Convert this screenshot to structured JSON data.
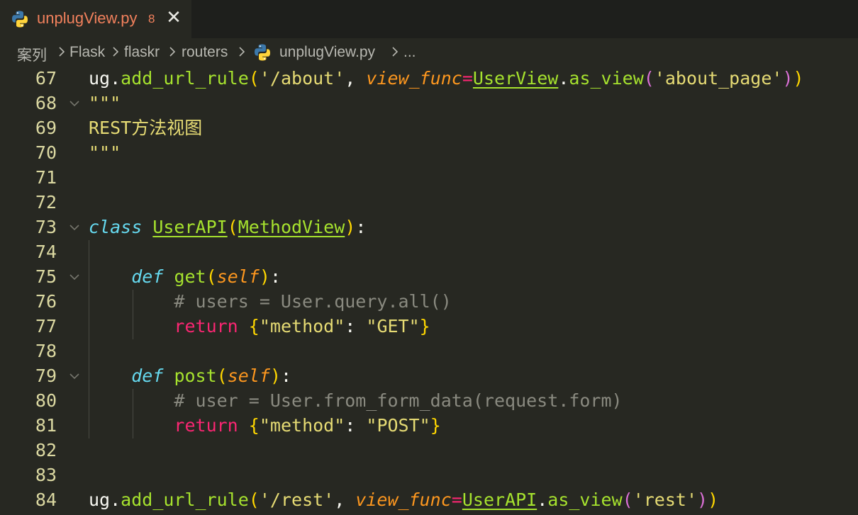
{
  "tab": {
    "file_name": "unplugView.py",
    "problem_count": "8",
    "close_glyph": "✕"
  },
  "breadcrumb": {
    "items": [
      "案列",
      "Flask",
      "flaskr",
      "routers",
      "unplugView.py",
      "..."
    ]
  },
  "colors": {
    "background": "#272822",
    "tab_bar": "#1e1f1c",
    "tab_title": "#f0805c",
    "line_number": "#dcd9a2",
    "function": "#a6e22e",
    "string": "#e6db74",
    "keyword": "#f92672",
    "def_keyword": "#66d9ef",
    "parameter": "#fd971f",
    "comment": "#8a8a80"
  },
  "icons": {
    "tab_icon": "python-icon",
    "breadcrumb_file_icon": "python-icon",
    "breadcrumb_separator": "chevron-right-icon",
    "fold": "chevron-down-icon"
  },
  "editor": {
    "lines": [
      {
        "num": "67",
        "fold": false,
        "tokens": [
          {
            "t": "ug",
            "c": "plain"
          },
          {
            "t": ".",
            "c": "plain"
          },
          {
            "t": "add_url_rule",
            "c": "func"
          },
          {
            "t": "(",
            "c": "b1"
          },
          {
            "t": "'/about'",
            "c": "str"
          },
          {
            "t": ", ",
            "c": "plain"
          },
          {
            "t": "view_func",
            "c": "param"
          },
          {
            "t": "=",
            "c": "kw"
          },
          {
            "t": "UserView",
            "c": "cls"
          },
          {
            "t": ".",
            "c": "plain"
          },
          {
            "t": "as_view",
            "c": "func"
          },
          {
            "t": "(",
            "c": "b2"
          },
          {
            "t": "'about_page'",
            "c": "str"
          },
          {
            "t": ")",
            "c": "b2"
          },
          {
            "t": ")",
            "c": "b1"
          }
        ]
      },
      {
        "num": "68",
        "fold": true,
        "tokens": [
          {
            "t": "\"\"\"",
            "c": "str"
          }
        ]
      },
      {
        "num": "69",
        "fold": false,
        "tokens": [
          {
            "t": "REST方法视图",
            "c": "str"
          }
        ]
      },
      {
        "num": "70",
        "fold": false,
        "tokens": [
          {
            "t": "\"\"\"",
            "c": "str"
          }
        ]
      },
      {
        "num": "71",
        "fold": false,
        "tokens": []
      },
      {
        "num": "72",
        "fold": false,
        "tokens": []
      },
      {
        "num": "73",
        "fold": true,
        "tokens": [
          {
            "t": "class",
            "c": "def"
          },
          {
            "t": " ",
            "c": "plain"
          },
          {
            "t": "UserAPI",
            "c": "cls"
          },
          {
            "t": "(",
            "c": "b1"
          },
          {
            "t": "MethodView",
            "c": "cls"
          },
          {
            "t": ")",
            "c": "b1"
          },
          {
            "t": ":",
            "c": "plain"
          }
        ]
      },
      {
        "num": "74",
        "fold": false,
        "tokens": []
      },
      {
        "num": "75",
        "fold": true,
        "tokens": [
          {
            "t": "    ",
            "c": "plain"
          },
          {
            "t": "def",
            "c": "def"
          },
          {
            "t": " ",
            "c": "plain"
          },
          {
            "t": "get",
            "c": "func"
          },
          {
            "t": "(",
            "c": "b1"
          },
          {
            "t": "self",
            "c": "param"
          },
          {
            "t": ")",
            "c": "b1"
          },
          {
            "t": ":",
            "c": "plain"
          }
        ]
      },
      {
        "num": "76",
        "fold": false,
        "tokens": [
          {
            "t": "        ",
            "c": "plain"
          },
          {
            "t": "# users = User.query.all()",
            "c": "com"
          }
        ]
      },
      {
        "num": "77",
        "fold": false,
        "tokens": [
          {
            "t": "        ",
            "c": "plain"
          },
          {
            "t": "return",
            "c": "kw"
          },
          {
            "t": " ",
            "c": "plain"
          },
          {
            "t": "{",
            "c": "b1"
          },
          {
            "t": "\"method\"",
            "c": "str"
          },
          {
            "t": ": ",
            "c": "plain"
          },
          {
            "t": "\"GET\"",
            "c": "str"
          },
          {
            "t": "}",
            "c": "b1"
          }
        ]
      },
      {
        "num": "78",
        "fold": false,
        "tokens": []
      },
      {
        "num": "79",
        "fold": true,
        "tokens": [
          {
            "t": "    ",
            "c": "plain"
          },
          {
            "t": "def",
            "c": "def"
          },
          {
            "t": " ",
            "c": "plain"
          },
          {
            "t": "post",
            "c": "func"
          },
          {
            "t": "(",
            "c": "b1"
          },
          {
            "t": "self",
            "c": "param"
          },
          {
            "t": ")",
            "c": "b1"
          },
          {
            "t": ":",
            "c": "plain"
          }
        ]
      },
      {
        "num": "80",
        "fold": false,
        "tokens": [
          {
            "t": "        ",
            "c": "plain"
          },
          {
            "t": "# user = User.from_form_data(request.form)",
            "c": "com"
          }
        ]
      },
      {
        "num": "81",
        "fold": false,
        "tokens": [
          {
            "t": "        ",
            "c": "plain"
          },
          {
            "t": "return",
            "c": "kw"
          },
          {
            "t": " ",
            "c": "plain"
          },
          {
            "t": "{",
            "c": "b1"
          },
          {
            "t": "\"method\"",
            "c": "str"
          },
          {
            "t": ": ",
            "c": "plain"
          },
          {
            "t": "\"POST\"",
            "c": "str"
          },
          {
            "t": "}",
            "c": "b1"
          }
        ]
      },
      {
        "num": "82",
        "fold": false,
        "tokens": []
      },
      {
        "num": "83",
        "fold": false,
        "tokens": []
      },
      {
        "num": "84",
        "fold": false,
        "tokens": [
          {
            "t": "ug",
            "c": "plain"
          },
          {
            "t": ".",
            "c": "plain"
          },
          {
            "t": "add_url_rule",
            "c": "func"
          },
          {
            "t": "(",
            "c": "b1"
          },
          {
            "t": "'/rest'",
            "c": "str"
          },
          {
            "t": ", ",
            "c": "plain"
          },
          {
            "t": "view_func",
            "c": "param"
          },
          {
            "t": "=",
            "c": "kw"
          },
          {
            "t": "UserAPI",
            "c": "cls"
          },
          {
            "t": ".",
            "c": "plain"
          },
          {
            "t": "as_view",
            "c": "func"
          },
          {
            "t": "(",
            "c": "b2"
          },
          {
            "t": "'rest'",
            "c": "str"
          },
          {
            "t": ")",
            "c": "b2"
          },
          {
            "t": ")",
            "c": "b1"
          }
        ]
      }
    ]
  }
}
